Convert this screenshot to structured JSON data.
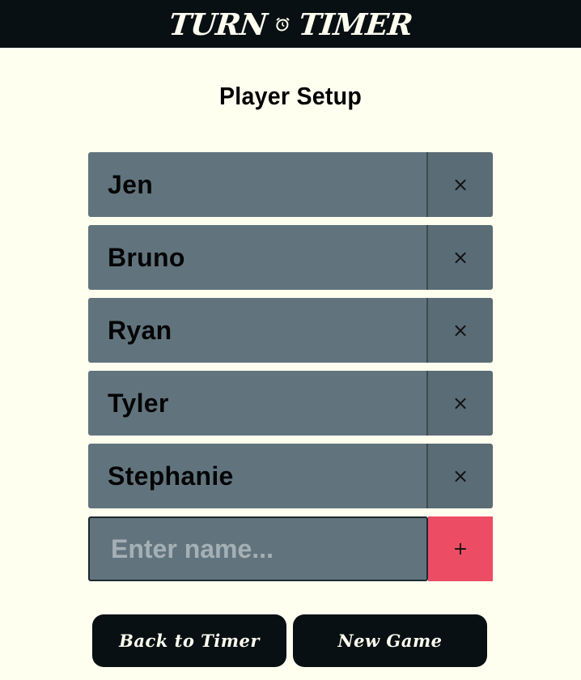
{
  "header": {
    "title_left": "TURN",
    "title_right": "TIMER",
    "icon": "alarm-clock-icon"
  },
  "page_title": "Player Setup",
  "players": [
    {
      "name": "Jen",
      "remove_label": "×"
    },
    {
      "name": "Bruno",
      "remove_label": "×"
    },
    {
      "name": "Ryan",
      "remove_label": "×"
    },
    {
      "name": "Tyler",
      "remove_label": "×"
    },
    {
      "name": "Stephanie",
      "remove_label": "×"
    }
  ],
  "add_player": {
    "placeholder": "Enter name...",
    "value": "",
    "add_label": "+"
  },
  "buttons": {
    "back": "Back to Timer",
    "new_game": "New Game"
  },
  "colors": {
    "header_bg": "#081013",
    "page_bg": "#fffff0",
    "row_bg": "#61747e",
    "remove_bg": "#5a6c75",
    "add_bg": "#ec4d64"
  }
}
